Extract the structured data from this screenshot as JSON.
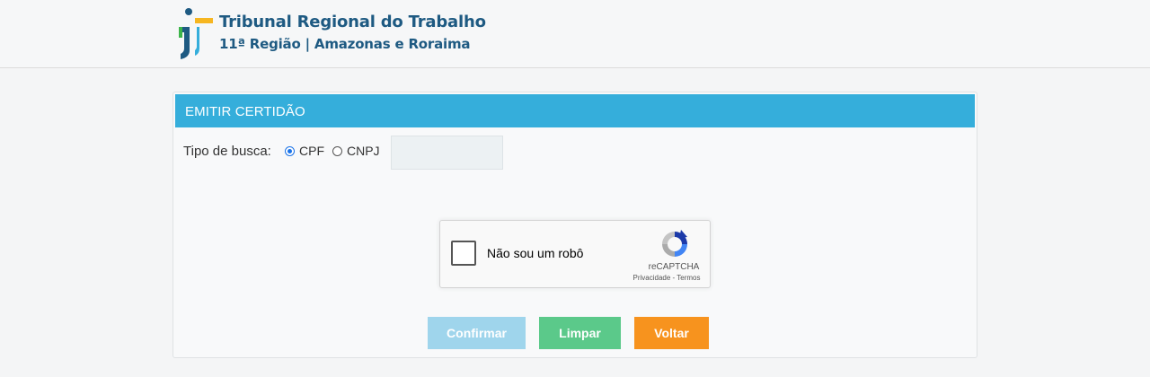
{
  "header": {
    "org_name": "Tribunal Regional do Trabalho",
    "org_region": "11ª Região | Amazonas e Roraima"
  },
  "form": {
    "title": "EMITIR CERTIDÃO",
    "search_type_label": "Tipo de busca:",
    "options": [
      {
        "label": "CPF",
        "selected": true
      },
      {
        "label": "CNPJ",
        "selected": false
      }
    ],
    "document_value": ""
  },
  "captcha": {
    "label": "Não sou um robô",
    "brand": "reCAPTCHA",
    "privacy_link": "Privacidade",
    "separator": "-",
    "terms_link": "Termos",
    "checked": false
  },
  "buttons": {
    "confirm_label": "Confirmar",
    "clear_label": "Limpar",
    "back_label": "Voltar"
  },
  "colors": {
    "panel_header": "#35aedb",
    "confirm": "#9fd5ec",
    "clear": "#5bc98a",
    "back": "#f7931e",
    "brand_text": "#1e5a82"
  }
}
